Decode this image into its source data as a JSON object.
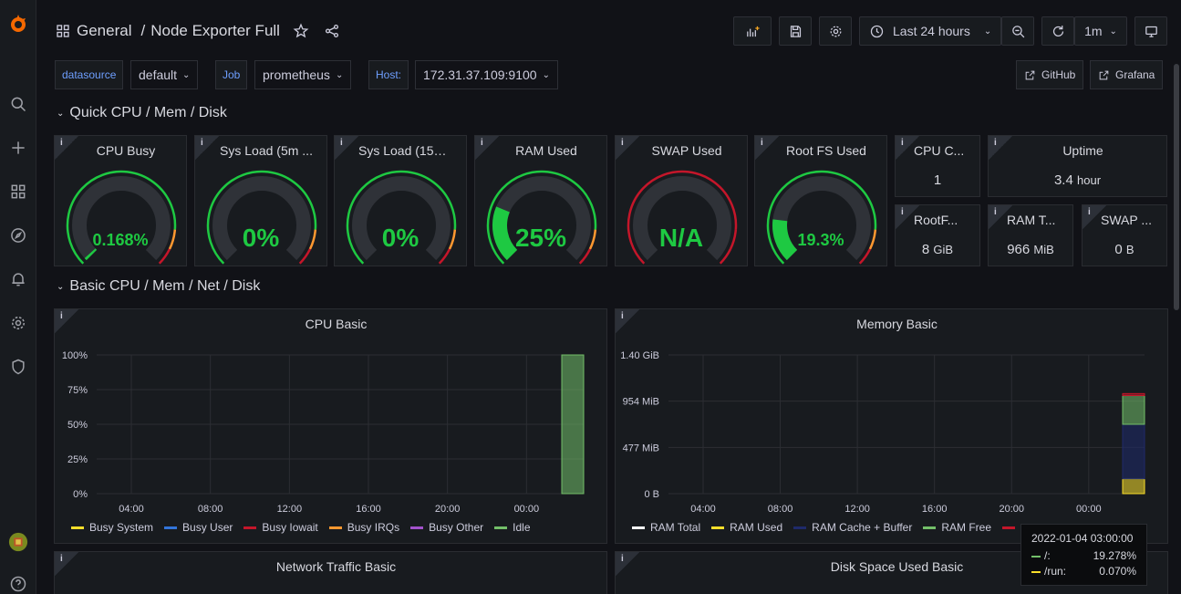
{
  "header": {
    "folder": "General",
    "separator": "/",
    "dashboard": "Node Exporter Full",
    "time_range": "Last 24 hours",
    "refresh": "1m"
  },
  "variables": [
    {
      "label": "datasource",
      "value": "default"
    },
    {
      "label": "Job",
      "value": "prometheus"
    },
    {
      "label": "Host:",
      "value": "172.31.37.109:9100"
    }
  ],
  "links": [
    {
      "label": "GitHub"
    },
    {
      "label": "Grafana"
    }
  ],
  "rows": {
    "quick": "Quick CPU / Mem / Disk",
    "basic": "Basic CPU / Mem / Net / Disk"
  },
  "gauges": [
    {
      "title": "CPU Busy",
      "display": "0.168%",
      "fraction": 0.00168,
      "color": "#1ec942"
    },
    {
      "title": "Sys Load (5m ...",
      "display": "0%",
      "fraction": 0,
      "color": "#1ec942"
    },
    {
      "title": "Sys Load (15m...",
      "display": "0%",
      "fraction": 0,
      "color": "#1ec942"
    },
    {
      "title": "RAM Used",
      "display": "25%",
      "fraction": 0.25,
      "color": "#1ec942"
    },
    {
      "title": "SWAP Used",
      "display": "N/A",
      "fraction": 0,
      "color": "#1ec942"
    },
    {
      "title": "Root FS Used",
      "display": "19.3%",
      "fraction": 0.193,
      "color": "#1ec942"
    }
  ],
  "stats": [
    {
      "title": "CPU C...",
      "value": "1",
      "unit": ""
    },
    {
      "title": "Uptime",
      "value": "3.4",
      "unit": "hour"
    },
    {
      "title": "RootF...",
      "value": "8",
      "unit": "GiB"
    },
    {
      "title": "RAM T...",
      "value": "966",
      "unit": "MiB"
    },
    {
      "title": "SWAP ...",
      "value": "0",
      "unit": "B"
    }
  ],
  "chart_data": [
    {
      "type": "area",
      "title": "CPU Basic",
      "x_ticks": [
        "04:00",
        "08:00",
        "12:00",
        "16:00",
        "20:00",
        "00:00"
      ],
      "y_ticks": [
        "100%",
        "75%",
        "50%",
        "25%",
        "0%"
      ],
      "ylim": [
        0,
        100
      ],
      "series": [
        {
          "name": "Busy System",
          "color": "#fade2a",
          "last": 0
        },
        {
          "name": "Busy User",
          "color": "#3274d9",
          "last": 0
        },
        {
          "name": "Busy Iowait",
          "color": "#c4162a",
          "last": 0
        },
        {
          "name": "Busy IRQs",
          "color": "#ff9830",
          "last": 0
        },
        {
          "name": "Busy Other",
          "color": "#a352cc",
          "last": 0
        },
        {
          "name": "Idle",
          "color": "#73bf69",
          "last": 100
        }
      ]
    },
    {
      "type": "area",
      "title": "Memory Basic",
      "x_ticks": [
        "04:00",
        "08:00",
        "12:00",
        "16:00",
        "20:00",
        "00:00"
      ],
      "y_ticks": [
        "1.40 GiB",
        "954 MiB",
        "477 MiB",
        "0 B"
      ],
      "ylim": [
        0,
        1.4
      ],
      "series": [
        {
          "name": "RAM Total",
          "color": "#ffffff"
        },
        {
          "name": "RAM Used",
          "color": "#fade2a",
          "last": 0.15
        },
        {
          "name": "RAM Cache + Buffer",
          "color": "#1f2a6b",
          "last": 0.55
        },
        {
          "name": "RAM Free",
          "color": "#73bf69",
          "last": 0.29
        },
        {
          "name": "",
          "color": "#c4162a",
          "last": 0.02
        }
      ]
    }
  ],
  "bottom_panels": {
    "network": "Network Traffic Basic",
    "disk": "Disk Space Used Basic"
  },
  "tooltip": {
    "time": "2022-01-04 03:00:00",
    "rows": [
      {
        "label": "/:",
        "value": "19.278%",
        "color": "#73bf69"
      },
      {
        "label": "/run:",
        "value": "0.070%",
        "color": "#fade2a"
      }
    ]
  }
}
